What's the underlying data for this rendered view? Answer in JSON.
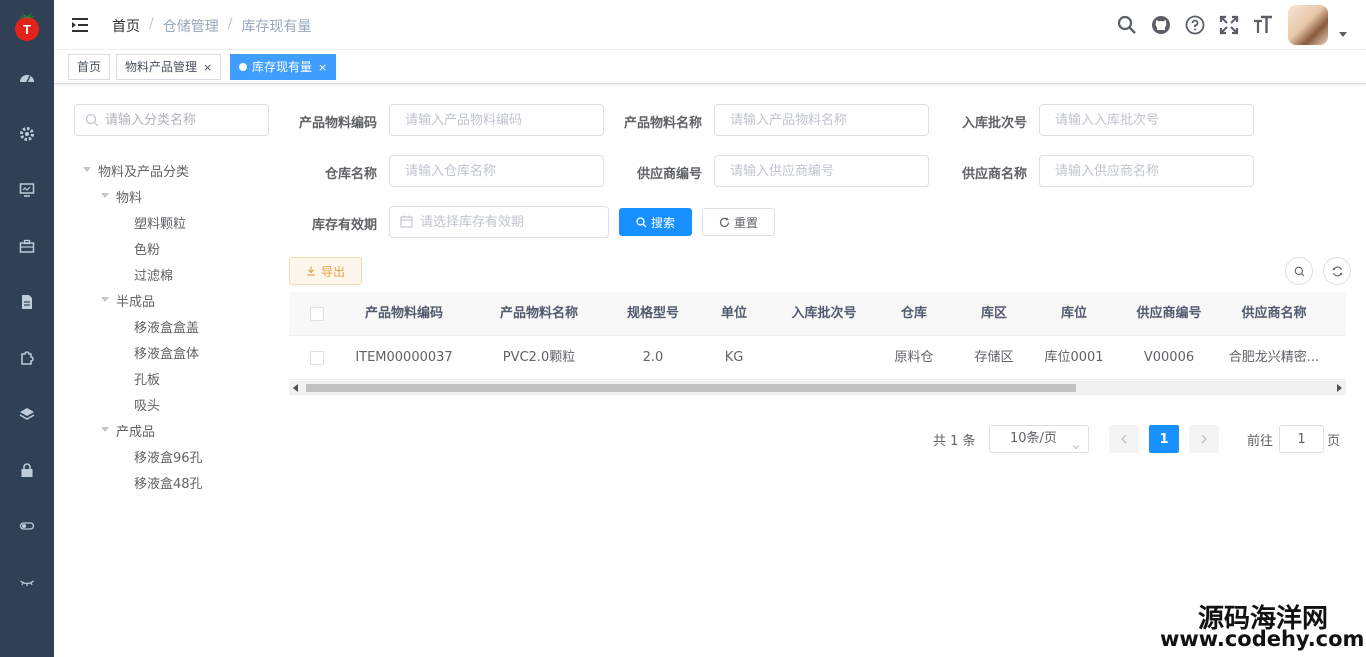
{
  "sidebar": {
    "icons": [
      "dashboard-icon",
      "gear-icon",
      "monitor-icon",
      "toolbox-icon",
      "document-icon",
      "puzzle-icon",
      "layers-icon",
      "lock-icon",
      "toggle-icon",
      "eye-icon"
    ]
  },
  "navbar": {
    "breadcrumb": [
      "首页",
      "仓储管理",
      "库存现有量"
    ],
    "tools": [
      "search-icon",
      "github-icon",
      "help-icon",
      "fullscreen-icon",
      "font-size-icon"
    ]
  },
  "tags": [
    {
      "label": "首页",
      "active": false
    },
    {
      "label": "物料产品管理",
      "active": false,
      "closable": true
    },
    {
      "label": "库存现有量",
      "active": true,
      "closable": true
    }
  ],
  "tree": {
    "search_placeholder": "请输入分类名称",
    "nodes": [
      {
        "label": "物料及产品分类",
        "level": 0,
        "expanded": true
      },
      {
        "label": "物料",
        "level": 1,
        "expanded": true
      },
      {
        "label": "塑料颗粒",
        "level": 2
      },
      {
        "label": "色粉",
        "level": 2
      },
      {
        "label": "过滤棉",
        "level": 2
      },
      {
        "label": "半成品",
        "level": 1,
        "expanded": true
      },
      {
        "label": "移液盒盒盖",
        "level": 2
      },
      {
        "label": "移液盒盒体",
        "level": 2
      },
      {
        "label": "孔板",
        "level": 2
      },
      {
        "label": "吸头",
        "level": 2
      },
      {
        "label": "产成品",
        "level": 1,
        "expanded": true
      },
      {
        "label": "移液盒96孔",
        "level": 2
      },
      {
        "label": "移液盒48孔",
        "level": 2
      }
    ]
  },
  "form": {
    "item_code": {
      "label": "产品物料编码",
      "placeholder": "请输入产品物料编码"
    },
    "item_name": {
      "label": "产品物料名称",
      "placeholder": "请输入产品物料名称"
    },
    "batch_code": {
      "label": "入库批次号",
      "placeholder": "请输入入库批次号"
    },
    "warehouse": {
      "label": "仓库名称",
      "placeholder": "请输入仓库名称"
    },
    "vendor_code": {
      "label": "供应商编号",
      "placeholder": "请输入供应商编号"
    },
    "vendor_name": {
      "label": "供应商名称",
      "placeholder": "请输入供应商名称"
    },
    "expire_date": {
      "label": "库存有效期",
      "placeholder": "请选择库存有效期"
    },
    "search_label": "搜索",
    "reset_label": "重置"
  },
  "toolbar": {
    "export_label": "导出"
  },
  "table": {
    "columns": [
      "产品物料编码",
      "产品物料名称",
      "规格型号",
      "单位",
      "入库批次号",
      "仓库",
      "库区",
      "库位",
      "供应商编号",
      "供应商名称"
    ],
    "rows": [
      [
        "ITEM00000037",
        "PVC2.0颗粒",
        "2.0",
        "KG",
        "",
        "原料仓",
        "存储区",
        "库位0001",
        "V00006",
        "合肥龙兴精密..."
      ]
    ]
  },
  "pagination": {
    "total_text": "共 1 条",
    "page_size": "10条/页",
    "current_page": "1",
    "goto_prefix": "前往",
    "goto_value": "1",
    "goto_suffix": "页"
  },
  "watermark": {
    "line1": "源码海洋网",
    "line2": "www.codehy.com"
  },
  "colors": {
    "sidebar_bg": "#304156",
    "primary": "#1890ff",
    "tag_active": "#409eff",
    "warning": "#e6a23c"
  }
}
